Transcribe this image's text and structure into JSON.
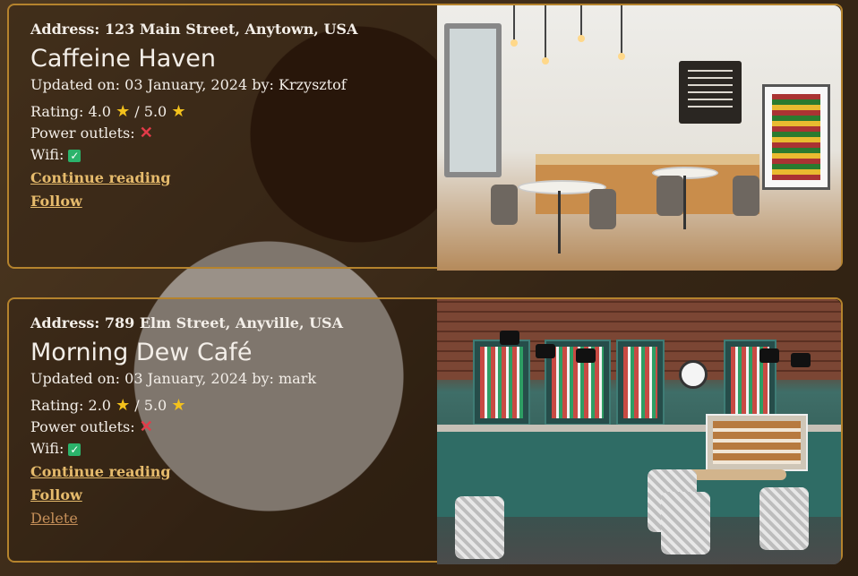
{
  "cards": [
    {
      "address": "Address: 123 Main Street, Anytown, USA",
      "name": "Caffeine Haven",
      "updated": "Updated on: 03 January, 2024 by: Krzysztof",
      "rating_label": "Rating: 4.0",
      "rating_sep": "/ 5.0",
      "power_label": "Power outlets:",
      "wifi_label": "Wifi:",
      "continue": "Continue reading",
      "follow": "Follow"
    },
    {
      "address": "Address: 789 Elm Street, Anyville, USA",
      "name": "Morning Dew Café",
      "updated": "Updated on: 03 January, 2024 by: mark",
      "rating_label": "Rating: 2.0",
      "rating_sep": "/ 5.0",
      "power_label": "Power outlets:",
      "wifi_label": "Wifi:",
      "continue": "Continue reading",
      "follow": "Follow",
      "delete": "Delete"
    }
  ],
  "icons": {
    "star": "star-icon",
    "power": "cross-icon",
    "wifi": "check-icon"
  },
  "colors": {
    "accent": "#b5832d",
    "link": "#e6bb6c",
    "text": "#f3eee8"
  }
}
